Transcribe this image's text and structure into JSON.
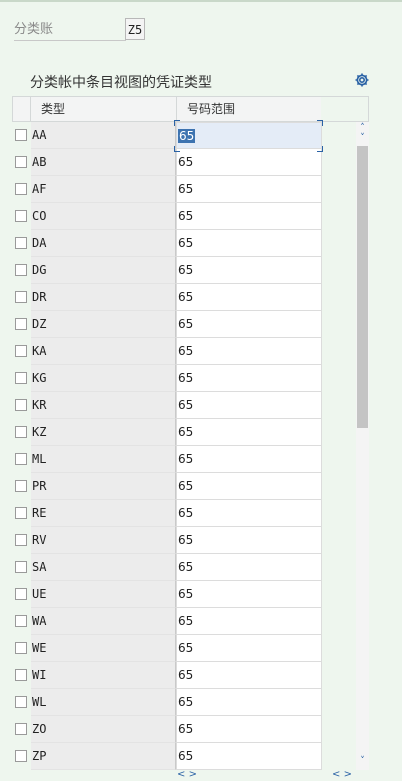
{
  "ledger": {
    "label": "分类账",
    "value": "Z5"
  },
  "section_title": "分类帐中条目视图的凭证类型",
  "settings_icon": "gear-icon",
  "columns": {
    "type": "类型",
    "range": "号码范围"
  },
  "rows": [
    {
      "type": "AA",
      "range": "65"
    },
    {
      "type": "AB",
      "range": "65"
    },
    {
      "type": "AF",
      "range": "65"
    },
    {
      "type": "CO",
      "range": "65"
    },
    {
      "type": "DA",
      "range": "65"
    },
    {
      "type": "DG",
      "range": "65"
    },
    {
      "type": "DR",
      "range": "65"
    },
    {
      "type": "DZ",
      "range": "65"
    },
    {
      "type": "KA",
      "range": "65"
    },
    {
      "type": "KG",
      "range": "65"
    },
    {
      "type": "KR",
      "range": "65"
    },
    {
      "type": "KZ",
      "range": "65"
    },
    {
      "type": "ML",
      "range": "65"
    },
    {
      "type": "PR",
      "range": "65"
    },
    {
      "type": "RE",
      "range": "65"
    },
    {
      "type": "RV",
      "range": "65"
    },
    {
      "type": "SA",
      "range": "65"
    },
    {
      "type": "UE",
      "range": "65"
    },
    {
      "type": "WA",
      "range": "65"
    },
    {
      "type": "WE",
      "range": "65"
    },
    {
      "type": "WI",
      "range": "65"
    },
    {
      "type": "WL",
      "range": "65"
    },
    {
      "type": "ZO",
      "range": "65"
    },
    {
      "type": "ZP",
      "range": "65"
    }
  ],
  "scroll": {
    "up": "˄",
    "down": "˅",
    "left": "<",
    "right": ">"
  },
  "colors": {
    "accent": "#2a62a5",
    "selection": "#3d73b0",
    "background": "#eef6ee"
  }
}
